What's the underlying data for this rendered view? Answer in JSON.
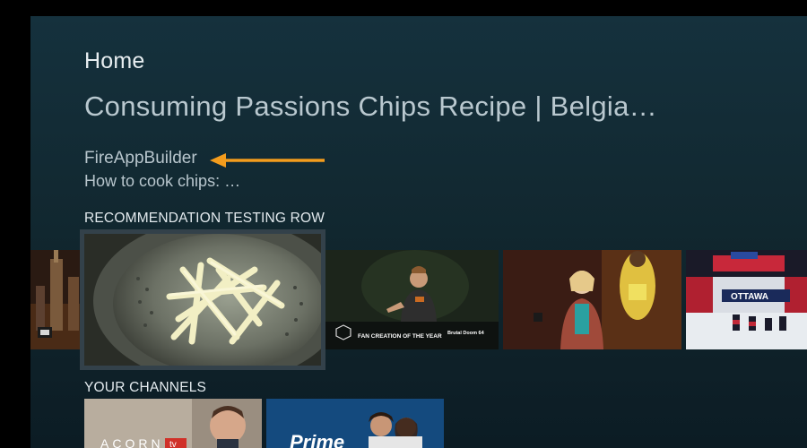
{
  "header": {
    "section_title": "Home",
    "featured_title": "Consuming Passions Chips Recipe | Belgia…",
    "app_name": "FireAppBuilder",
    "description": "How to cook chips: …"
  },
  "rows": {
    "recommendations": {
      "label": "RECOMMENDATION TESTING ROW",
      "tiles": [
        {
          "name": "tile-city-night"
        },
        {
          "name": "tile-chips-colander",
          "focused": true
        },
        {
          "name": "tile-fan-creation-award",
          "caption": "FAN CREATION OF THE YEAR",
          "caption_right": "Brutal Doom 64"
        },
        {
          "name": "tile-speaker-stage"
        },
        {
          "name": "tile-ottawa-event",
          "caption": "OTTAWA"
        }
      ]
    },
    "channels": {
      "label": "YOUR CHANNELS",
      "tiles": [
        {
          "name": "channel-acorn-tv",
          "brand": "ACORN",
          "brand_badge": "tv"
        },
        {
          "name": "channel-prime",
          "brand": "Prime"
        }
      ]
    }
  },
  "colors": {
    "accent_arrow": "#f39c1d",
    "focus_border": "#33414a",
    "background": "#12293333"
  }
}
